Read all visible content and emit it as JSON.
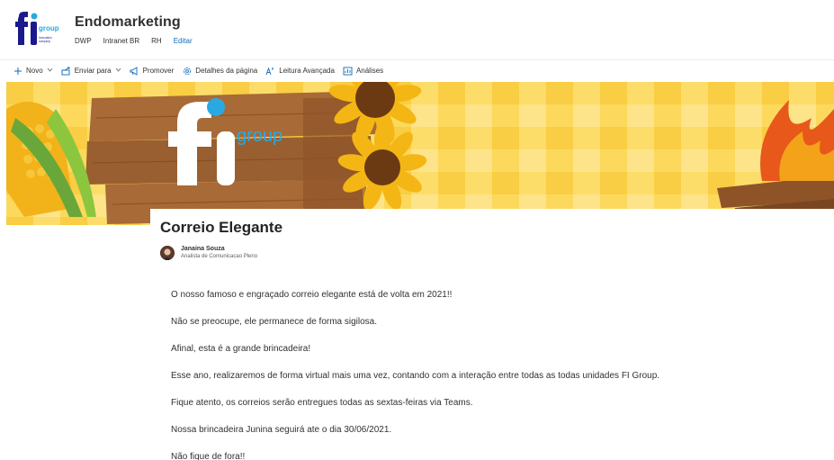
{
  "site": {
    "title": "Endomarketing",
    "logo": {
      "word": "group",
      "tagline_1": "Innovation",
      "tagline_2": "company"
    },
    "nav": [
      {
        "label": "DWP"
      },
      {
        "label": "Intranet BR"
      },
      {
        "label": "RH"
      },
      {
        "label": "Editar"
      }
    ]
  },
  "commandbar": {
    "items": [
      {
        "label": "Novo",
        "icon": "plus-icon"
      },
      {
        "label": "Enviar para",
        "icon": "share-icon"
      },
      {
        "label": "Promover",
        "icon": "megaphone-icon"
      },
      {
        "label": "Detalhes da página",
        "icon": "gear-icon"
      },
      {
        "label": "Leitura Avançada",
        "icon": "immersive-reader-icon"
      },
      {
        "label": "Análises",
        "icon": "analytics-icon"
      }
    ]
  },
  "banner": {
    "logo_word": "group"
  },
  "article": {
    "title": "Correio Elegante",
    "author": {
      "name": "Janaina Souza",
      "role": "Analista de Comunicacao Pleno"
    },
    "paragraphs": [
      "O nosso famoso e engraçado correio elegante está de volta em 2021!!",
      "Não se preocupe, ele permanece de forma sigilosa.",
      "Afinal, esta é a grande brincadeira!",
      "Esse ano, realizaremos de forma virtual mais uma vez, contando com a interação entre todas as todas unidades FI Group.",
      "Fique atento, os correios serão entregues todas as sextas-feiras via Teams.",
      "Nossa brincadeira Junina seguirá ate o dia 30/06/2021.",
      "Não fique de fora!!"
    ]
  },
  "colors": {
    "brand_navy": "#1a1a8c",
    "brand_cyan": "#29a9e1",
    "accent_blue": "#0f6cbd",
    "banner_yellow": "#fbd650",
    "wood": "#9a6332"
  }
}
